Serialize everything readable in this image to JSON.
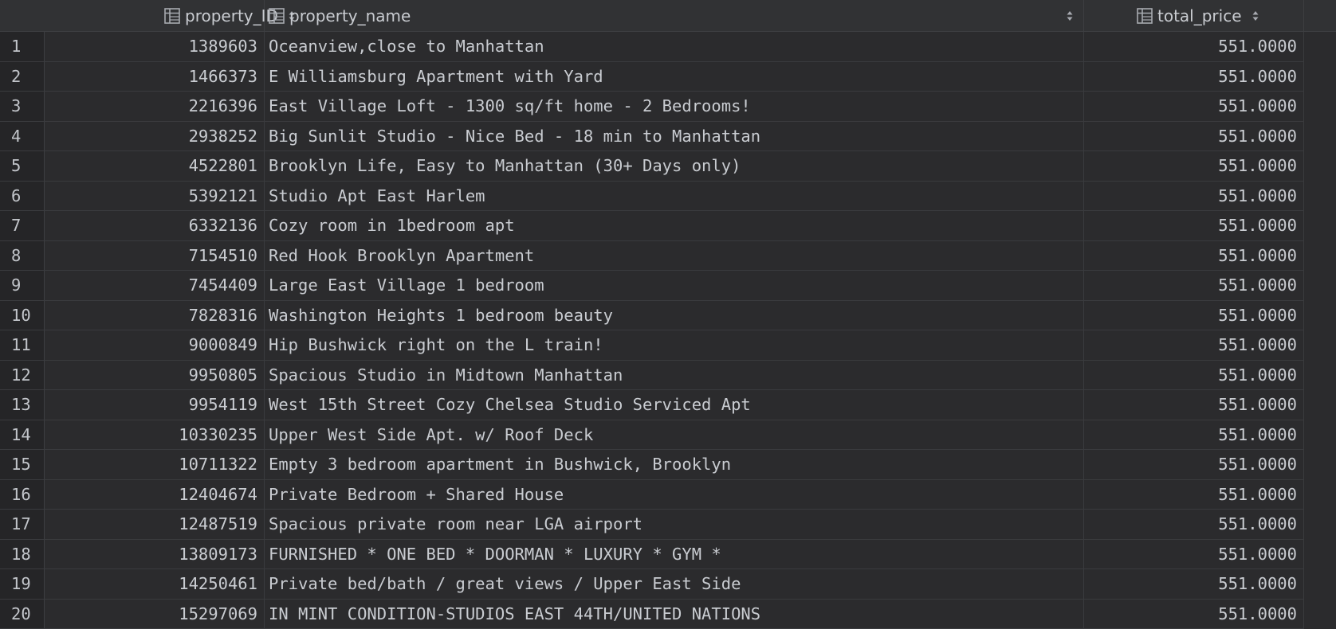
{
  "columns": [
    {
      "label": "property_ID",
      "icon": "table-column-icon",
      "sort_icon": "sort-arrows-icon"
    },
    {
      "label": "property_name",
      "icon": "table-column-icon",
      "sort_icon": "sort-arrows-icon"
    },
    {
      "label": "total_price",
      "icon": "table-column-icon",
      "sort_icon": "sort-arrows-icon"
    }
  ],
  "rows": [
    {
      "n": "1",
      "id": "1389603",
      "name": "Oceanview,close to Manhattan",
      "price": "551.0000"
    },
    {
      "n": "2",
      "id": "1466373",
      "name": "E Williamsburg Apartment with Yard",
      "price": "551.0000"
    },
    {
      "n": "3",
      "id": "2216396",
      "name": "East Village Loft - 1300 sq/ft home - 2 Bedrooms!",
      "price": "551.0000"
    },
    {
      "n": "4",
      "id": "2938252",
      "name": "Big Sunlit Studio - Nice Bed - 18 min to Manhattan",
      "price": "551.0000"
    },
    {
      "n": "5",
      "id": "4522801",
      "name": "Brooklyn Life, Easy to Manhattan (30+ Days only)",
      "price": "551.0000"
    },
    {
      "n": "6",
      "id": "5392121",
      "name": "Studio Apt East Harlem",
      "price": "551.0000"
    },
    {
      "n": "7",
      "id": "6332136",
      "name": "Cozy room in 1bedroom apt",
      "price": "551.0000"
    },
    {
      "n": "8",
      "id": "7154510",
      "name": "Red Hook Brooklyn Apartment",
      "price": "551.0000"
    },
    {
      "n": "9",
      "id": "7454409",
      "name": "Large East Village 1 bedroom",
      "price": "551.0000"
    },
    {
      "n": "10",
      "id": "7828316",
      "name": "Washington Heights 1 bedroom beauty",
      "price": "551.0000"
    },
    {
      "n": "11",
      "id": "9000849",
      "name": "Hip Bushwick right on the L train!",
      "price": "551.0000"
    },
    {
      "n": "12",
      "id": "9950805",
      "name": "Spacious Studio in Midtown Manhattan",
      "price": "551.0000"
    },
    {
      "n": "13",
      "id": "9954119",
      "name": "West 15th Street Cozy Chelsea Studio Serviced Apt",
      "price": "551.0000"
    },
    {
      "n": "14",
      "id": "10330235",
      "name": "Upper West Side Apt. w/ Roof Deck",
      "price": "551.0000"
    },
    {
      "n": "15",
      "id": "10711322",
      "name": "Empty 3 bedroom apartment in Bushwick, Brooklyn",
      "price": "551.0000"
    },
    {
      "n": "16",
      "id": "12404674",
      "name": "Private Bedroom + Shared House",
      "price": "551.0000"
    },
    {
      "n": "17",
      "id": "12487519",
      "name": "Spacious private room near LGA airport",
      "price": "551.0000"
    },
    {
      "n": "18",
      "id": "13809173",
      "name": "FURNISHED * ONE BED * DOORMAN * LUXURY * GYM *",
      "price": "551.0000"
    },
    {
      "n": "19",
      "id": "14250461",
      "name": "Private bed/bath / great views / Upper East Side",
      "price": "551.0000"
    },
    {
      "n": "20",
      "id": "15297069",
      "name": "IN MINT CONDITION-STUDIOS EAST 44TH/UNITED NATIONS",
      "price": "551.0000"
    }
  ],
  "colors": {
    "background": "#2b2b2d",
    "header": "#313234",
    "text": "#c9ccd1"
  }
}
